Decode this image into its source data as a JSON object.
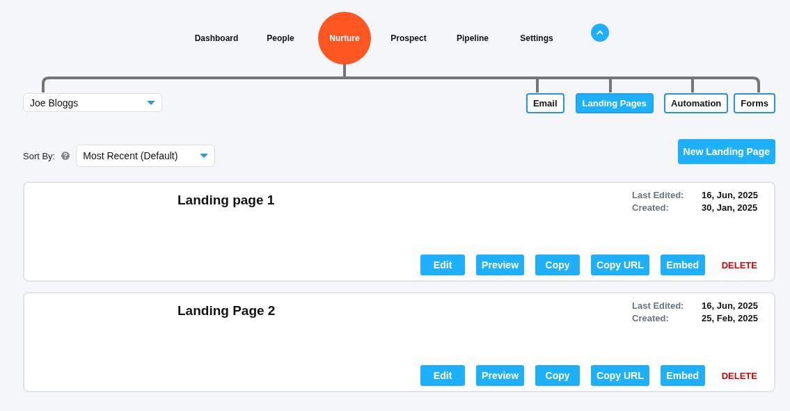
{
  "nav": [
    {
      "label": "Dashboard",
      "selected": false
    },
    {
      "label": "People",
      "selected": false
    },
    {
      "label": "Nurture",
      "selected": true
    },
    {
      "label": "Prospect",
      "selected": false
    },
    {
      "label": "Pipeline",
      "selected": false
    },
    {
      "label": "Settings",
      "selected": false
    }
  ],
  "user_select": {
    "value": "Joe Bloggs"
  },
  "subtabs": [
    {
      "label": "Email",
      "selected": false
    },
    {
      "label": "Landing Pages",
      "selected": true
    },
    {
      "label": "Automation",
      "selected": false
    },
    {
      "label": "Forms",
      "selected": false
    }
  ],
  "sort": {
    "label": "Sort By:",
    "value": "Most Recent (Default)"
  },
  "new_button": "New Landing Page",
  "pages": [
    {
      "title": "Landing page 1",
      "last_edited_label": "Last Edited:",
      "last_edited": "16, Jun, 2025",
      "created_label": "Created:",
      "created": "30, Jan, 2025",
      "actions": [
        "Edit",
        "Preview",
        "Copy",
        "Copy URL",
        "Embed"
      ],
      "delete": "DELETE"
    },
    {
      "title": "Landing Page 2",
      "last_edited_label": "Last Edited:",
      "last_edited": "16, Jun, 2025",
      "created_label": "Created:",
      "created": "25, Feb, 2025",
      "actions": [
        "Edit",
        "Preview",
        "Copy",
        "Copy URL",
        "Embed"
      ],
      "delete": "DELETE"
    }
  ]
}
